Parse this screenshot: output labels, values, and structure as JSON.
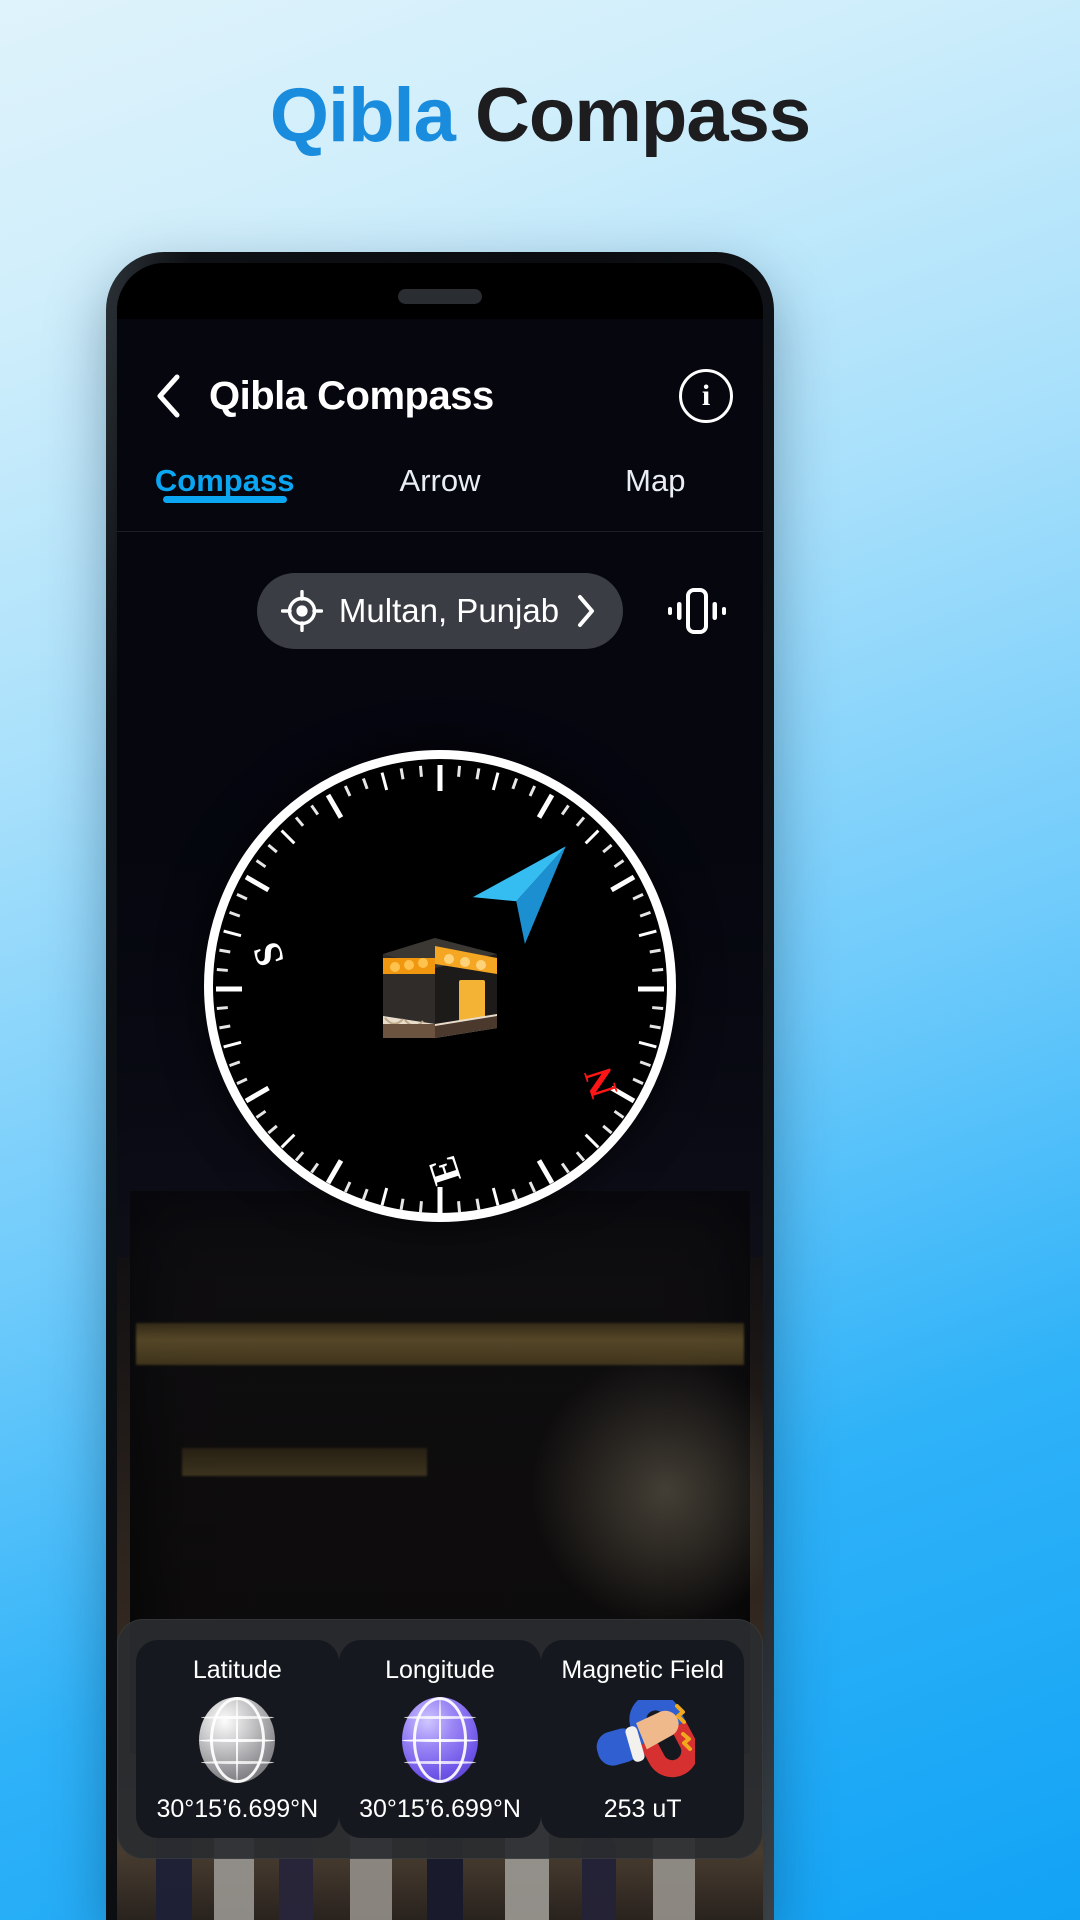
{
  "promo": {
    "word1": "Qibla",
    "word2": "Compass",
    "accent_color": "#1a8cdd",
    "dark_color": "#1d1d1f"
  },
  "app": {
    "header": {
      "back_icon": "chevron-left-icon",
      "title": "Qibla Compass",
      "info_icon": "info-icon",
      "info_glyph": "i"
    },
    "tabs": [
      {
        "label": "Compass",
        "active": true
      },
      {
        "label": "Arrow",
        "active": false
      },
      {
        "label": "Map",
        "active": false
      }
    ],
    "active_tab_color": "#0aa6f2",
    "location": {
      "icon": "crosshair-location-icon",
      "name": "Multan, Punjab",
      "chevron_icon": "chevron-right-icon",
      "vibrate_icon": "vibrate-icon"
    },
    "compass": {
      "kaaba_icon": "kaaba-icon",
      "needle_icon": "qibla-needle-icon",
      "needle_color": "#29a9e8",
      "cardinals": [
        {
          "label": "S",
          "color": "#ffffff"
        },
        {
          "label": "E",
          "color": "#ffffff"
        },
        {
          "label": "N",
          "color": "#ff1515"
        }
      ]
    },
    "info_cards": [
      {
        "title": "Latitude",
        "value": "30°15’6.699°N",
        "icon": "globe-grey-icon"
      },
      {
        "title": "Longitude",
        "value": "30°15’6.699°N",
        "icon": "globe-purple-icon"
      },
      {
        "title": "Magnetic Field",
        "value": "253 uT",
        "icon": "magnet-hand-icon"
      }
    ]
  }
}
